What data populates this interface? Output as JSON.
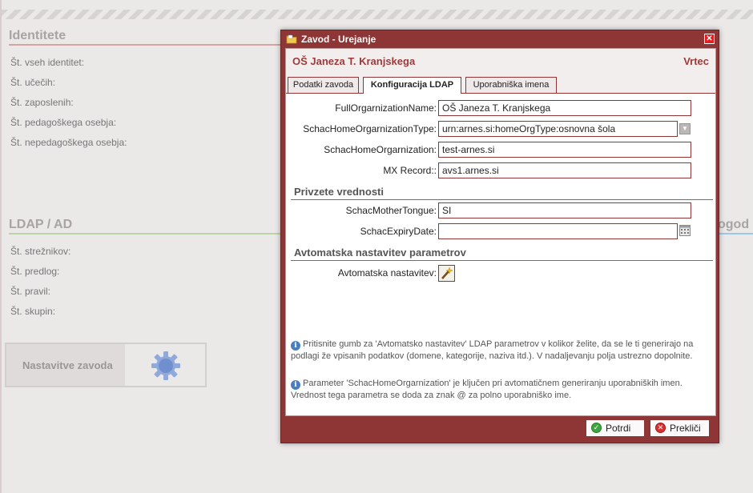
{
  "background": {
    "identities": {
      "title": "Identitete",
      "stats": [
        "Št. vseh identitet:",
        "Št. učečih:",
        "Št. zaposlenih:",
        "Št. pedagoškega osebja:",
        "Št. nepedagoškega osebja:"
      ]
    },
    "ldap": {
      "title": "LDAP / AD",
      "stats": [
        "Št. strežnikov:",
        "Št. predlog:",
        "Št. pravil:",
        "Št. skupin:"
      ]
    },
    "right_fragment": "ogod",
    "settings_button": "Nastavitve zavoda"
  },
  "dialog": {
    "title": "Zavod - Urejanje",
    "school_name": "OŠ Janeza T. Kranjskega",
    "school_type": "Vrtec",
    "tabs": [
      {
        "label": "Podatki zavoda"
      },
      {
        "label": "Konfiguracija LDAP"
      },
      {
        "label": "Uporabniška imena"
      }
    ],
    "fields": {
      "full_org_name": {
        "label": "FullOrgarnizationName:",
        "value": "OŠ Janeza T. Kranjskega"
      },
      "home_org_type": {
        "label": "SchacHomeOrgarnizationType:",
        "value": "urn:arnes.si:homeOrgType:osnovna šola"
      },
      "home_org": {
        "label": "SchacHomeOrgarnization:",
        "value": "test-arnes.si"
      },
      "mx_record": {
        "label": "MX Record::",
        "value": "avs1.arnes.si"
      }
    },
    "private_section": {
      "title": "Privzete vrednosti",
      "mother_tongue": {
        "label": "SchacMotherTongue:",
        "value": "SI"
      },
      "expiry_date": {
        "label": "SchacExpiryDate:",
        "value": ""
      }
    },
    "auto_section": {
      "title": "Avtomatska nastavitev parametrov",
      "label": "Avtomatska nastavitev:"
    },
    "info": [
      "Pritisnite gumb za 'Avtomatsko nastavitev' LDAP parametrov v kolikor želite, da se le ti generirajo na podlagi že vpisanih podatkov (domene, kategorije, naziva itd.). V nadaljevanju polja ustrezno dopolnite.",
      "Parameter 'SchacHomeOrgarnization' je ključen pri avtomatičnem generiranju uporabniških imen. Vrednost tega parametra se doda za znak @ za polno uporabniško ime."
    ],
    "buttons": {
      "confirm": "Potrdi",
      "cancel": "Prekliči"
    }
  },
  "colors": {
    "dialog_frame": "#8e3535",
    "accent_text": "#9d3a3a",
    "identities_rule": "#d4a3a3",
    "ldap_rule": "#b9d4a8",
    "right_rule": "#9cc8e6"
  },
  "icons": {
    "dialog_title": "folder-icon",
    "close": "close-icon",
    "combo": "dropdown-arrow-icon",
    "calendar": "calendar-icon",
    "auto": "magic-wand-icon",
    "info": "info-icon",
    "confirm": "check-icon",
    "cancel": "cancel-icon",
    "settings": "gear-icon"
  }
}
